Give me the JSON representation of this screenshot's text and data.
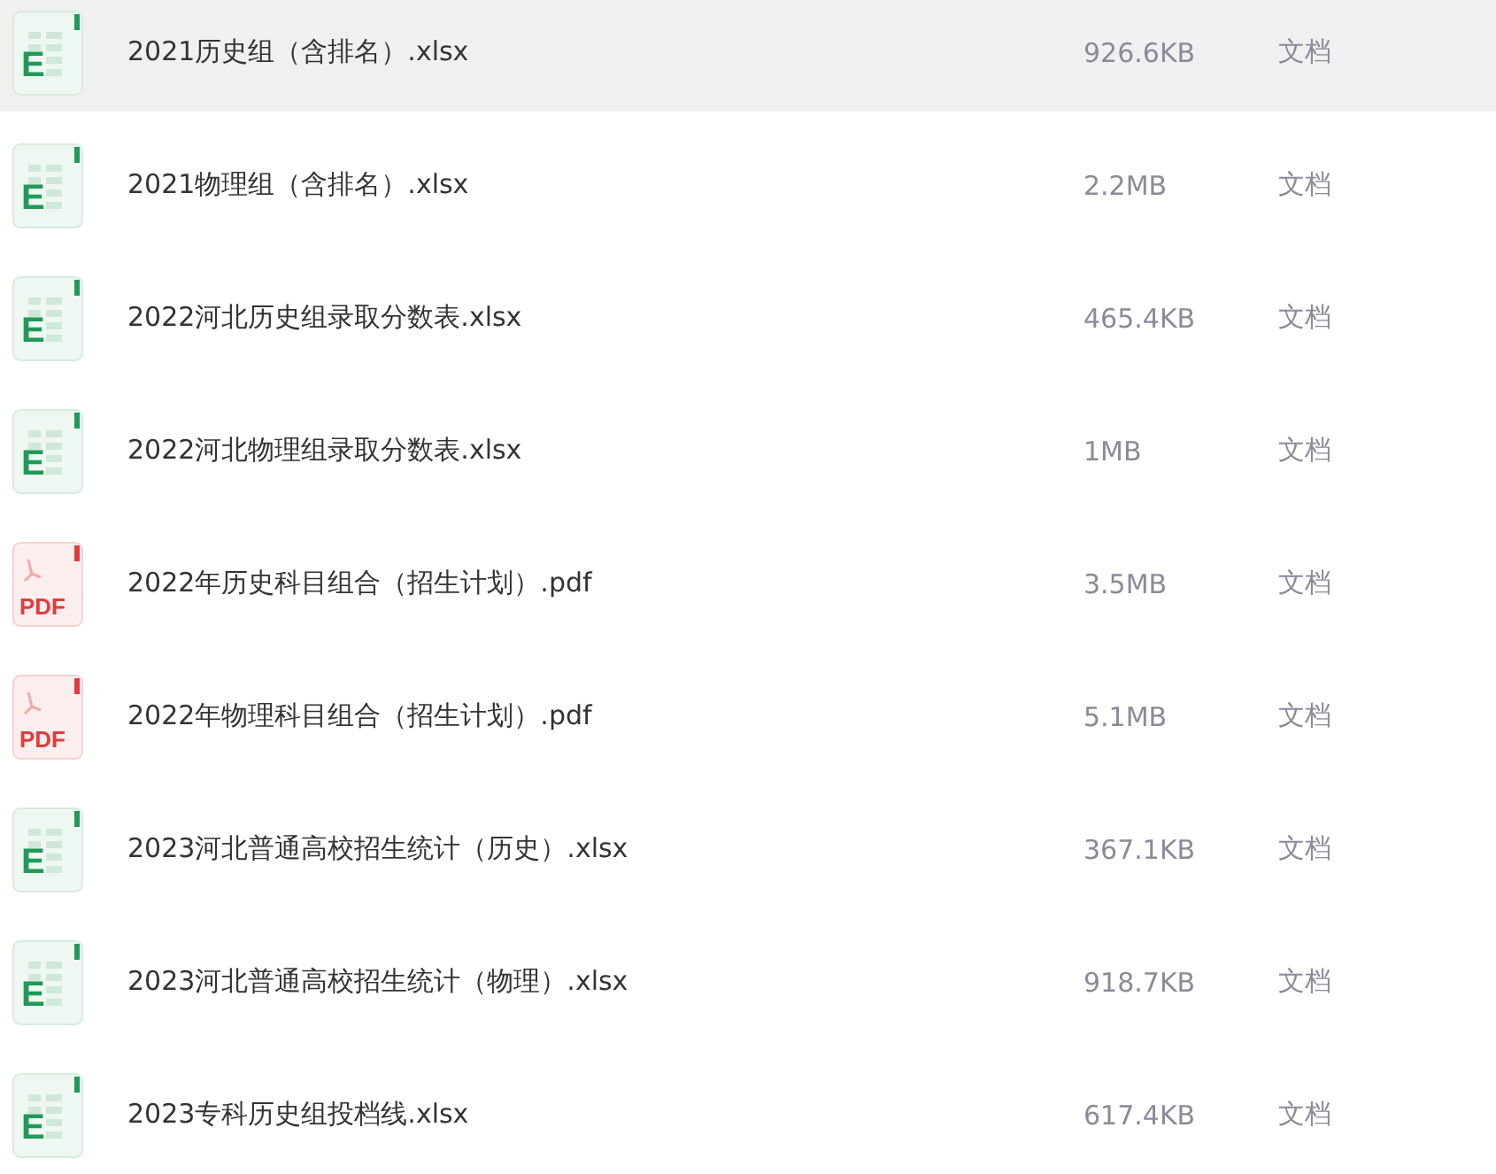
{
  "files": [
    {
      "kind": "xlsx",
      "icon_label": "E",
      "name": "2021历史组（含排名）.xlsx",
      "size": "926.6KB",
      "type": "文档",
      "selected": true
    },
    {
      "kind": "xlsx",
      "icon_label": "E",
      "name": "2021物理组（含排名）.xlsx",
      "size": "2.2MB",
      "type": "文档",
      "selected": false
    },
    {
      "kind": "xlsx",
      "icon_label": "E",
      "name": "2022河北历史组录取分数表.xlsx",
      "size": "465.4KB",
      "type": "文档",
      "selected": false
    },
    {
      "kind": "xlsx",
      "icon_label": "E",
      "name": "2022河北物理组录取分数表.xlsx",
      "size": "1MB",
      "type": "文档",
      "selected": false
    },
    {
      "kind": "pdf",
      "icon_label": "PDF",
      "name": "2022年历史科目组合（招生计划）.pdf",
      "size": "3.5MB",
      "type": "文档",
      "selected": false
    },
    {
      "kind": "pdf",
      "icon_label": "PDF",
      "name": "2022年物理科目组合（招生计划）.pdf",
      "size": "5.1MB",
      "type": "文档",
      "selected": false
    },
    {
      "kind": "xlsx",
      "icon_label": "E",
      "name": "2023河北普通高校招生统计（历史）.xlsx",
      "size": "367.1KB",
      "type": "文档",
      "selected": false
    },
    {
      "kind": "xlsx",
      "icon_label": "E",
      "name": "2023河北普通高校招生统计（物理）.xlsx",
      "size": "918.7KB",
      "type": "文档",
      "selected": false
    },
    {
      "kind": "xlsx",
      "icon_label": "E",
      "name": "2023专科历史组投档线.xlsx",
      "size": "617.4KB",
      "type": "文档",
      "selected": false
    }
  ]
}
